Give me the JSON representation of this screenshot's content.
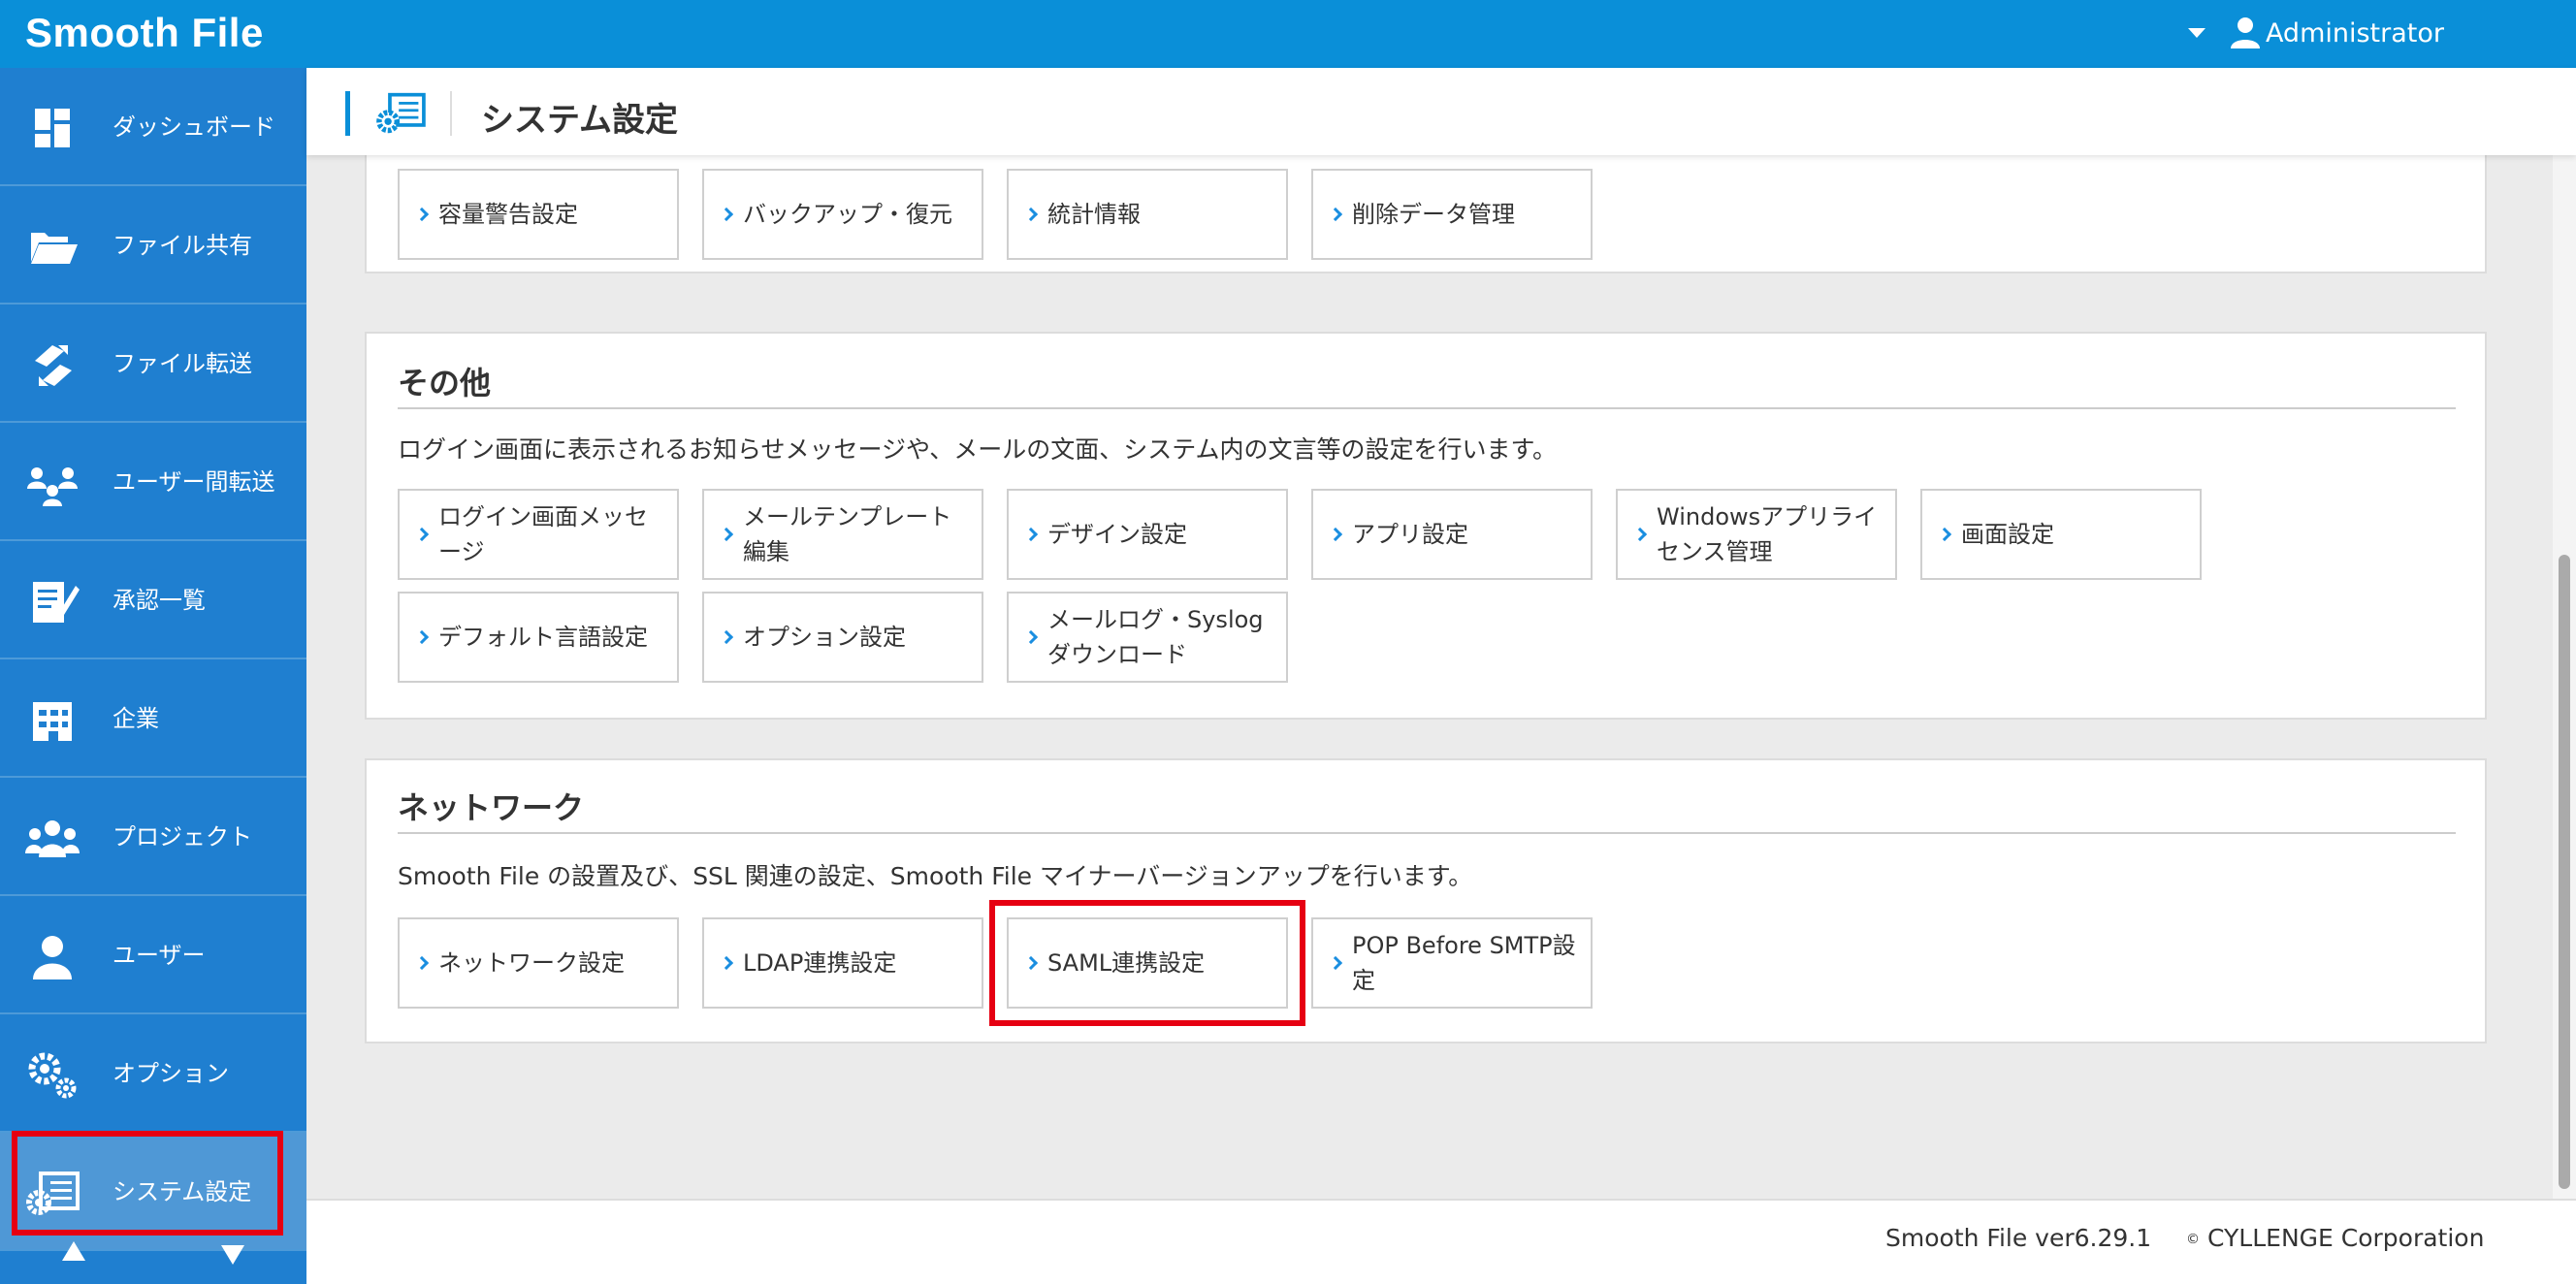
{
  "app": {
    "logo": "Smooth File"
  },
  "topbar": {
    "user_name": "Administrator"
  },
  "sidebar": {
    "items": [
      {
        "label": "ダッシュボード",
        "icon": "dashboard-icon"
      },
      {
        "label": "ファイル共有",
        "icon": "folder-open-icon"
      },
      {
        "label": "ファイル転送",
        "icon": "file-transfer-icon"
      },
      {
        "label": "ユーザー間転送",
        "icon": "user-transfer-icon"
      },
      {
        "label": "承認一覧",
        "icon": "approval-list-icon"
      },
      {
        "label": "企業",
        "icon": "company-building-icon"
      },
      {
        "label": "プロジェクト",
        "icon": "project-group-icon"
      },
      {
        "label": "ユーザー",
        "icon": "user-icon"
      },
      {
        "label": "オプション",
        "icon": "gears-icon"
      },
      {
        "label": "システム設定",
        "icon": "system-settings-icon",
        "active": true
      }
    ]
  },
  "header": {
    "title": "システム設定",
    "icon": "system-settings-icon"
  },
  "sections": {
    "top": {
      "tiles": [
        "容量警告設定",
        "バックアップ・復元",
        "統計情報",
        "削除データ管理"
      ]
    },
    "other": {
      "title": "その他",
      "description": "ログイン画面に表示されるお知らせメッセージや、メールの文面、システム内の文言等の設定を行います。",
      "tiles": [
        "ログイン画面メッセージ",
        "メールテンプレート編集",
        "デザイン設定",
        "アプリ設定",
        "Windowsアプリライセンス管理",
        "画面設定",
        "デフォルト言語設定",
        "オプション設定",
        "メールログ・Syslogダウンロード"
      ]
    },
    "network": {
      "title": "ネットワーク",
      "description": "Smooth File の設置及び、SSL 関連の設定、Smooth File マイナーバージョンアップを行います。",
      "tiles": [
        "ネットワーク設定",
        "LDAP連携設定",
        "SAML連携設定",
        "POP Before SMTP設定"
      ]
    }
  },
  "footer": {
    "version": "Smooth File ver6.29.1",
    "copyright_symbol": "©",
    "copyright": "CYLLENGE Corporation"
  },
  "colors": {
    "brand_blue": "#0a8fd8",
    "sidebar_blue": "#1f7fd0",
    "highlight_red": "#e60012"
  }
}
